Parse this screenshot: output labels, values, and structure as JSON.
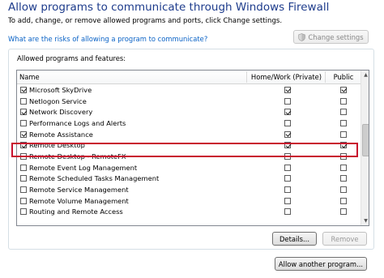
{
  "window": {
    "title": "Allow programs to communicate through Windows Firewall",
    "subtitle": "To add, change, or remove allowed programs and ports, click Change settings.",
    "risk_link": "What are the risks of allowing a program to communicate?",
    "change_settings_label": "Change settings"
  },
  "group": {
    "label": "Allowed programs and features:"
  },
  "table": {
    "columns": {
      "name": "Name",
      "home": "Home/Work (Private)",
      "public": "Public"
    },
    "rows": [
      {
        "name": "Microsoft SkyDrive",
        "enabled": true,
        "home": true,
        "public": true
      },
      {
        "name": "Netlogon Service",
        "enabled": false,
        "home": false,
        "public": false
      },
      {
        "name": "Network Discovery",
        "enabled": true,
        "home": true,
        "public": false
      },
      {
        "name": "Performance Logs and Alerts",
        "enabled": false,
        "home": false,
        "public": false
      },
      {
        "name": "Remote Assistance",
        "enabled": true,
        "home": true,
        "public": false
      },
      {
        "name": "Remote Desktop",
        "enabled": true,
        "home": true,
        "public": true
      },
      {
        "name": "Remote Desktop - RemoteFX",
        "enabled": false,
        "home": false,
        "public": false
      },
      {
        "name": "Remote Event Log Management",
        "enabled": false,
        "home": false,
        "public": false
      },
      {
        "name": "Remote Scheduled Tasks Management",
        "enabled": false,
        "home": false,
        "public": false
      },
      {
        "name": "Remote Service Management",
        "enabled": false,
        "home": false,
        "public": false
      },
      {
        "name": "Remote Volume Management",
        "enabled": false,
        "home": false,
        "public": false
      },
      {
        "name": "Routing and Remote Access",
        "enabled": false,
        "home": false,
        "public": false
      }
    ],
    "highlighted_row": "Remote Desktop"
  },
  "buttons": {
    "details": "Details...",
    "remove": "Remove",
    "allow_another": "Allow another program..."
  },
  "colors": {
    "title": "#1e3c8c",
    "link": "#0b63c6",
    "highlight_border": "#c8102e"
  },
  "icons": {
    "change_settings": "uac-shield-icon"
  }
}
